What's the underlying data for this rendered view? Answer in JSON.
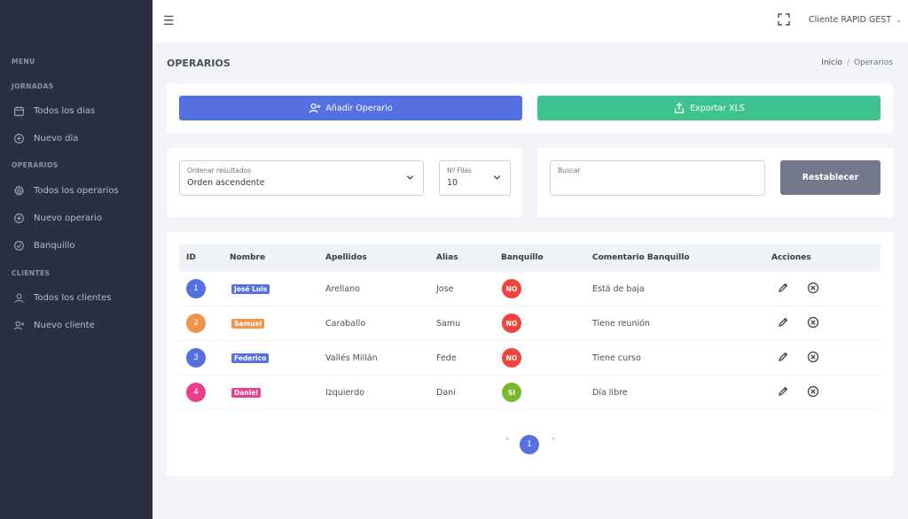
{
  "sidebar": {
    "sections": {
      "menu": "MENU",
      "jornadas": "JORNADAS",
      "operarios": "OPERARIOS",
      "clientes": "CLIENTES"
    },
    "items": {
      "todos_dias": "Todos los dias",
      "nuevo_dia": "Nuevo día",
      "todos_operarios": "Todos los operarios",
      "nuevo_operario": "Nuevo operario",
      "banquillo": "Banquillo",
      "todos_clientes": "Todos los clientes",
      "nuevo_cliente": "Nuevo cliente"
    }
  },
  "header": {
    "user": "Cliente RAPID GEST"
  },
  "page": {
    "title": "OPERARIOS",
    "breadcrumb": {
      "home": "Inicio",
      "separator": "/",
      "current": "Operarios"
    }
  },
  "actions": {
    "add": "Añadir Operario",
    "export": "Exportar XLS"
  },
  "filters": {
    "order_label": "Ordenar resultados",
    "order_value": "Orden ascendente",
    "rows_label": "Nº Filas",
    "rows_value": "10",
    "search_label": "Buscar",
    "search_value": "",
    "reset": "Restablecer"
  },
  "table": {
    "headers": {
      "id": "ID",
      "nombre": "Nombre",
      "apellidos": "Apellidos",
      "alias": "Alias",
      "banquillo": "Banquillo",
      "comentario": "Comentario Banquillo",
      "acciones": "Acciones"
    },
    "rows": [
      {
        "id": "1",
        "nombre": "José Luis",
        "apellidos": "Arellano",
        "alias": "Jose",
        "banquillo": "NO",
        "comentario": "Está de baja",
        "id_color": "#5470e1",
        "bq_color": "#f0443d"
      },
      {
        "id": "2",
        "nombre": "Samuel",
        "apellidos": "Caraballo",
        "alias": "Samu",
        "banquillo": "NO",
        "comentario": "Tiene reunión",
        "id_color": "#f1944a",
        "bq_color": "#f0443d"
      },
      {
        "id": "3",
        "nombre": "Federico",
        "apellidos": "Vallés Millán",
        "alias": "Fede",
        "banquillo": "NO",
        "comentario": "Tiene curso",
        "id_color": "#5470e1",
        "bq_color": "#f0443d"
      },
      {
        "id": "4",
        "nombre": "Daniel",
        "apellidos": "Izquierdo",
        "alias": "Dani",
        "banquillo": "SI",
        "comentario": "Día libre",
        "id_color": "#e83e8c",
        "bq_color": "#7ab92e"
      }
    ]
  },
  "pagination": {
    "prev": "‹",
    "current": "1",
    "next": "›"
  },
  "colors": {
    "primary": "#5470e1",
    "success": "#3ec28f",
    "secondary": "#74788d",
    "sidebar": "#2a2f42"
  },
  "icons": {
    "menu": "hamburger-icon",
    "fullscreen": "fullscreen-icon",
    "calendar": "calendar-icon",
    "plus_circle": "plus-circle-icon",
    "gear": "gear-icon",
    "check_circle": "check-circle-icon",
    "user": "user-icon",
    "user_plus": "user-plus-icon",
    "export": "export-icon",
    "edit": "pencil-icon",
    "delete": "close-circle-icon"
  }
}
